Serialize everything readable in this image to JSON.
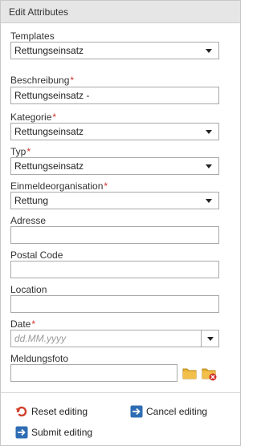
{
  "header": {
    "title": "Edit Attributes"
  },
  "form": {
    "templates": {
      "label": "Templates",
      "value": "Rettungseinsatz"
    },
    "beschreibung": {
      "label": "Beschreibung",
      "required_mark": "*",
      "value": "Rettungseinsatz -"
    },
    "kategorie": {
      "label": "Kategorie",
      "required_mark": "*",
      "value": "Rettungseinsatz"
    },
    "typ": {
      "label": "Typ",
      "required_mark": "*",
      "value": "Rettungseinsatz"
    },
    "einmeldeorganisation": {
      "label": "Einmeldeorganisation",
      "required_mark": "*",
      "value": "Rettung"
    },
    "adresse": {
      "label": "Adresse",
      "value": ""
    },
    "postal_code": {
      "label": "Postal Code",
      "value": ""
    },
    "location": {
      "label": "Location",
      "value": ""
    },
    "date": {
      "label": "Date",
      "required_mark": "*",
      "placeholder": "dd.MM.yyyy"
    },
    "meldungsfoto": {
      "label": "Meldungsfoto",
      "value": ""
    }
  },
  "actions": {
    "reset_label": "Reset editing",
    "cancel_label": "Cancel editing",
    "submit_label": "Submit editing"
  },
  "icons": {
    "caret": "chevron-down-icon",
    "folder": "folder-icon",
    "remove": "folder-remove-icon",
    "reset": "undo-icon",
    "cancel": "arrow-right-icon",
    "submit": "arrow-right-icon"
  },
  "colors": {
    "required": "#d0312d",
    "accent_blue": "#2e6db4",
    "reset_red": "#d0402c",
    "folder": "#e8b030"
  }
}
